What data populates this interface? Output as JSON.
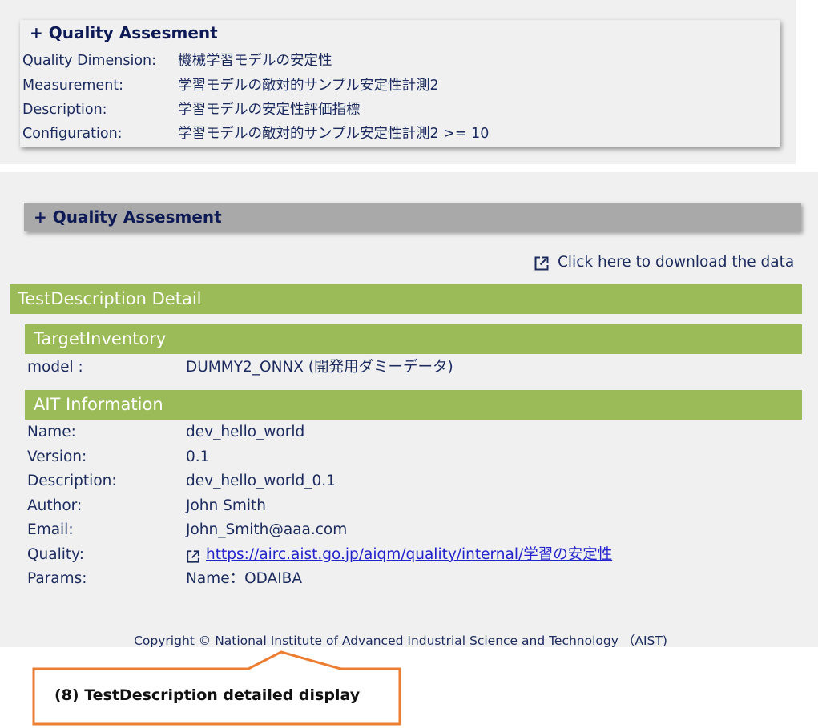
{
  "top_panel": {
    "title": "+ Quality Assesment",
    "rows": [
      {
        "label": "Quality Dimension:",
        "value": "機械学習モデルの安定性"
      },
      {
        "label": "Measurement:",
        "value": "学習モデルの敵対的サンプル安定性計測2"
      },
      {
        "label": "Description:",
        "value": "学習モデルの安定性評価指標"
      },
      {
        "label": "Configuration:",
        "value": "学習モデルの敵対的サンプル安定性計測2 >= 10"
      }
    ]
  },
  "bottom_panel": {
    "quality_bar_title": "+ Quality Assesment",
    "download_label": "Click here to download the data",
    "detail_header": "TestDescription Detail",
    "target_inventory": {
      "header": "TargetInventory",
      "label": "model :",
      "value": "DUMMY2_ONNX (開発用ダミーデータ)"
    },
    "ait_information": {
      "header": "AIT Information",
      "name_label": "Name:",
      "name_value": "dev_hello_world",
      "version_label": "Version:",
      "version_value": "0.1",
      "description_label": "Description:",
      "description_value": "dev_hello_world_0.1",
      "author_label": "Author:",
      "author_value": "John Smith",
      "email_label": "Email:",
      "email_value": "John_Smith@aaa.com",
      "quality_label": "Quality:",
      "quality_value": "https://airc.aist.go.jp/aiqm/quality/internal/学習の安定性",
      "params_label": "Params:",
      "params_value": "Name：ODAIBA"
    },
    "copyright": "Copyright © National Institute of Advanced Industrial Science and Technology （AIST)"
  },
  "callout": {
    "text": "(8) TestDescription detailed display",
    "border_color": "#ed7d31"
  },
  "colors": {
    "header_green": "#9bbb59",
    "panel_gray": "#f0f0f0",
    "bar_gray": "#a9a9a9",
    "title_navy": "#0d1a56",
    "link_blue": "#2323cc"
  }
}
